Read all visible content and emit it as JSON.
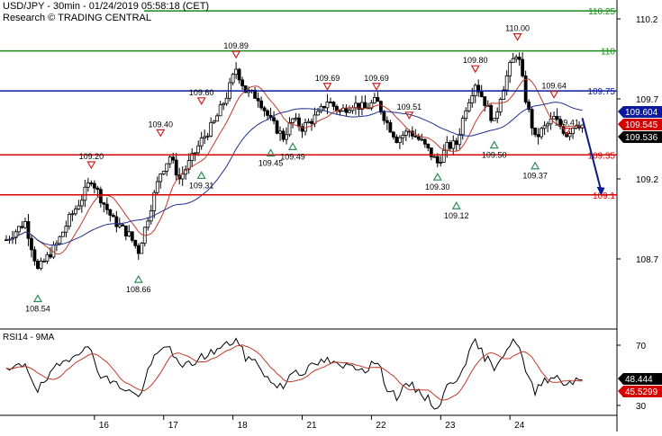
{
  "header": {
    "symbol_line": "USD/JPY - 30min - 01/24/2019 05:58:18 (CET)",
    "research_line": "Research © TRADING CENTRAL"
  },
  "colors": {
    "green_level": "#1a8a1a",
    "blue_level": "#0a1a9a",
    "red_level": "#d40000",
    "candle": "#000000",
    "ma_fast": "#c0392b",
    "ma_slow": "#1f2f8f",
    "rsi": "#000000",
    "rsi_ma": "#c0392b",
    "forecast_arrow": "#0a1a8a",
    "marker_up": "#2e8b57",
    "marker_down": "#cc2222",
    "badge_blue": "#0a1a9a",
    "badge_red": "#d40000",
    "badge_black": "#000000"
  },
  "chart_data": [
    {
      "type": "candlestick",
      "title": "USD/JPY - 30min",
      "ylim": [
        108.5,
        110.25
      ],
      "y_ticks": [
        "110.2",
        "109.7",
        "109.2",
        "108.7"
      ],
      "x_ticks": [
        "16",
        "17",
        "18",
        "21",
        "22",
        "23",
        "24"
      ],
      "levels": [
        {
          "value": 110.25,
          "label": "110.25",
          "color": "green"
        },
        {
          "value": 110.0,
          "label": "110",
          "color": "green"
        },
        {
          "value": 109.75,
          "label": "109.75",
          "color": "blue"
        },
        {
          "value": 109.35,
          "label": "109.35",
          "color": "red"
        },
        {
          "value": 109.1,
          "label": "109.1",
          "color": "red"
        }
      ],
      "price_badges": [
        {
          "label": "109.604",
          "style": "blue"
        },
        {
          "label": "109.545",
          "style": "red"
        },
        {
          "label": "109.536",
          "style": "black"
        }
      ],
      "close_path": [
        [
          0,
          108.82
        ],
        [
          3,
          108.93
        ],
        [
          5,
          108.63
        ],
        [
          8,
          108.79
        ],
        [
          10,
          108.95
        ],
        [
          12,
          109.08
        ],
        [
          13.5,
          109.2
        ],
        [
          15,
          109.08
        ],
        [
          17,
          108.94
        ],
        [
          19.5,
          108.85
        ],
        [
          21,
          108.75
        ],
        [
          23,
          109.03
        ],
        [
          24.5,
          109.24
        ],
        [
          26,
          109.34
        ],
        [
          27.5,
          109.2
        ],
        [
          29.5,
          109.33
        ],
        [
          31,
          109.44
        ],
        [
          33,
          109.55
        ],
        [
          35,
          109.72
        ],
        [
          36.5,
          109.89
        ],
        [
          38,
          109.75
        ],
        [
          40,
          109.71
        ],
        [
          42,
          109.56
        ],
        [
          44,
          109.46
        ],
        [
          45.5,
          109.57
        ],
        [
          47,
          109.52
        ],
        [
          49.5,
          109.6
        ],
        [
          51,
          109.69
        ],
        [
          53,
          109.62
        ],
        [
          55,
          109.67
        ],
        [
          57,
          109.64
        ],
        [
          58.8,
          109.69
        ],
        [
          60.5,
          109.55
        ],
        [
          62,
          109.45
        ],
        [
          64,
          109.5
        ],
        [
          66,
          109.43
        ],
        [
          68.5,
          109.3
        ],
        [
          70,
          109.4
        ],
        [
          71.5,
          109.42
        ],
        [
          73,
          109.65
        ],
        [
          74.5,
          109.8
        ],
        [
          76,
          109.68
        ],
        [
          77.5,
          109.55
        ],
        [
          78.5,
          109.72
        ],
        [
          80,
          109.9
        ],
        [
          81.2,
          110.0
        ],
        [
          82.5,
          109.7
        ],
        [
          84,
          109.45
        ],
        [
          85,
          109.5
        ],
        [
          87,
          109.58
        ],
        [
          89,
          109.48
        ],
        [
          90.5,
          109.55
        ],
        [
          91.5,
          109.536
        ]
      ],
      "annotations": [
        {
          "x": 5,
          "y": 108.54,
          "dir": "up",
          "label": "108.54"
        },
        {
          "x": 13.5,
          "y": 109.2,
          "dir": "down",
          "label": "109.20"
        },
        {
          "x": 21,
          "y": 108.66,
          "dir": "up",
          "label": "108.66"
        },
        {
          "x": 24.5,
          "y": 109.4,
          "dir": "down",
          "label": "109.40"
        },
        {
          "x": 31,
          "y": 109.31,
          "dir": "up",
          "label": "109.31"
        },
        {
          "x": 31,
          "y": 109.6,
          "dir": "down",
          "label": "109.60"
        },
        {
          "x": 36.5,
          "y": 109.89,
          "dir": "down",
          "label": "109.89"
        },
        {
          "x": 42,
          "y": 109.45,
          "dir": "up",
          "label": "109.45"
        },
        {
          "x": 45.5,
          "y": 109.49,
          "dir": "up",
          "label": "109.49"
        },
        {
          "x": 51,
          "y": 109.69,
          "dir": "down",
          "label": "109.69"
        },
        {
          "x": 58.8,
          "y": 109.69,
          "dir": "down",
          "label": "109.69"
        },
        {
          "x": 64,
          "y": 109.51,
          "dir": "down",
          "label": "109.51"
        },
        {
          "x": 68.5,
          "y": 109.3,
          "dir": "up",
          "label": "109.30"
        },
        {
          "x": 71.5,
          "y": 109.12,
          "dir": "up",
          "label": "109.12"
        },
        {
          "x": 74.5,
          "y": 109.8,
          "dir": "down",
          "label": "109.80"
        },
        {
          "x": 77.5,
          "y": 109.5,
          "dir": "up",
          "label": "109.50"
        },
        {
          "x": 81.2,
          "y": 110.0,
          "dir": "down",
          "label": "110.00"
        },
        {
          "x": 84,
          "y": 109.37,
          "dir": "up",
          "label": "109.37"
        },
        {
          "x": 87,
          "y": 109.64,
          "dir": "down",
          "label": "109.64"
        },
        {
          "x": 89,
          "y": 109.41,
          "dir": "down",
          "label": "109.41"
        }
      ],
      "forecast": {
        "from": [
          91.5,
          109.58
        ],
        "to": [
          94.5,
          109.1
        ]
      }
    },
    {
      "type": "line",
      "title": "RSI14 - 9MA",
      "ylim": [
        25,
        78
      ],
      "y_ticks": [
        "70",
        "30"
      ],
      "series": [
        {
          "name": "RSI14",
          "current": 48.444
        },
        {
          "name": "9MA",
          "current": 45.5299
        }
      ],
      "rsi_path": [
        [
          0,
          52
        ],
        [
          3,
          58
        ],
        [
          5,
          40
        ],
        [
          8,
          55
        ],
        [
          10,
          62
        ],
        [
          12,
          68
        ],
        [
          13.5,
          66
        ],
        [
          15,
          50
        ],
        [
          17,
          45
        ],
        [
          19.5,
          40
        ],
        [
          21,
          35
        ],
        [
          23,
          58
        ],
        [
          24.5,
          66
        ],
        [
          26,
          70
        ],
        [
          27.5,
          55
        ],
        [
          29.5,
          58
        ],
        [
          31,
          62
        ],
        [
          33,
          66
        ],
        [
          35,
          70
        ],
        [
          36.5,
          74
        ],
        [
          38,
          62
        ],
        [
          40,
          58
        ],
        [
          42,
          45
        ],
        [
          44,
          42
        ],
        [
          45.5,
          54
        ],
        [
          47,
          52
        ],
        [
          49.5,
          58
        ],
        [
          51,
          60
        ],
        [
          53,
          55
        ],
        [
          55,
          57
        ],
        [
          57,
          54
        ],
        [
          58.8,
          60
        ],
        [
          60.5,
          42
        ],
        [
          62,
          36
        ],
        [
          64,
          44
        ],
        [
          66,
          38
        ],
        [
          68.5,
          28
        ],
        [
          70,
          42
        ],
        [
          71.5,
          48
        ],
        [
          73,
          60
        ],
        [
          74.5,
          72
        ],
        [
          76,
          62
        ],
        [
          77.5,
          56
        ],
        [
          78.5,
          62
        ],
        [
          80,
          70
        ],
        [
          81.2,
          74
        ],
        [
          82.5,
          52
        ],
        [
          84,
          38
        ],
        [
          85,
          46
        ],
        [
          87,
          50
        ],
        [
          89,
          44
        ],
        [
          90.5,
          48
        ],
        [
          91.5,
          48.444
        ]
      ]
    }
  ]
}
